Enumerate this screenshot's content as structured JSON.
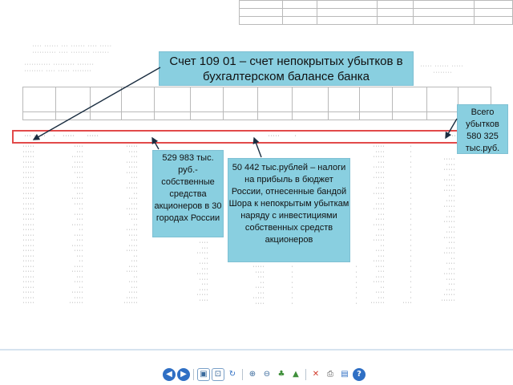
{
  "callouts": {
    "title": "Счет 109 01 – счет непокрытых убытков в бухгалтерском балансе банка",
    "total": "Всего убытков 580 325 тыс.руб.",
    "left": "529 983 тыс. руб.- собственные средства акционеров в 30 городах России",
    "middle": "50 442 тыс.рублей – налоги на прибыль в бюджет России, отнесенные бандой Шора к непокрытым убыткам наряду с инвестициями собственных средств акционеров"
  },
  "toolbar": {
    "icons": [
      "nav-left-icon",
      "nav-right-icon",
      "fit-page-icon",
      "fit-width-icon",
      "rotate-icon",
      "zoom-in-icon",
      "zoom-out-icon",
      "tree-icon",
      "landscape-icon",
      "close-icon",
      "print-icon",
      "save-icon",
      "help-icon"
    ]
  },
  "colors": {
    "callout_bg": "#89cfe0",
    "highlight_border": "#e24a4a"
  }
}
